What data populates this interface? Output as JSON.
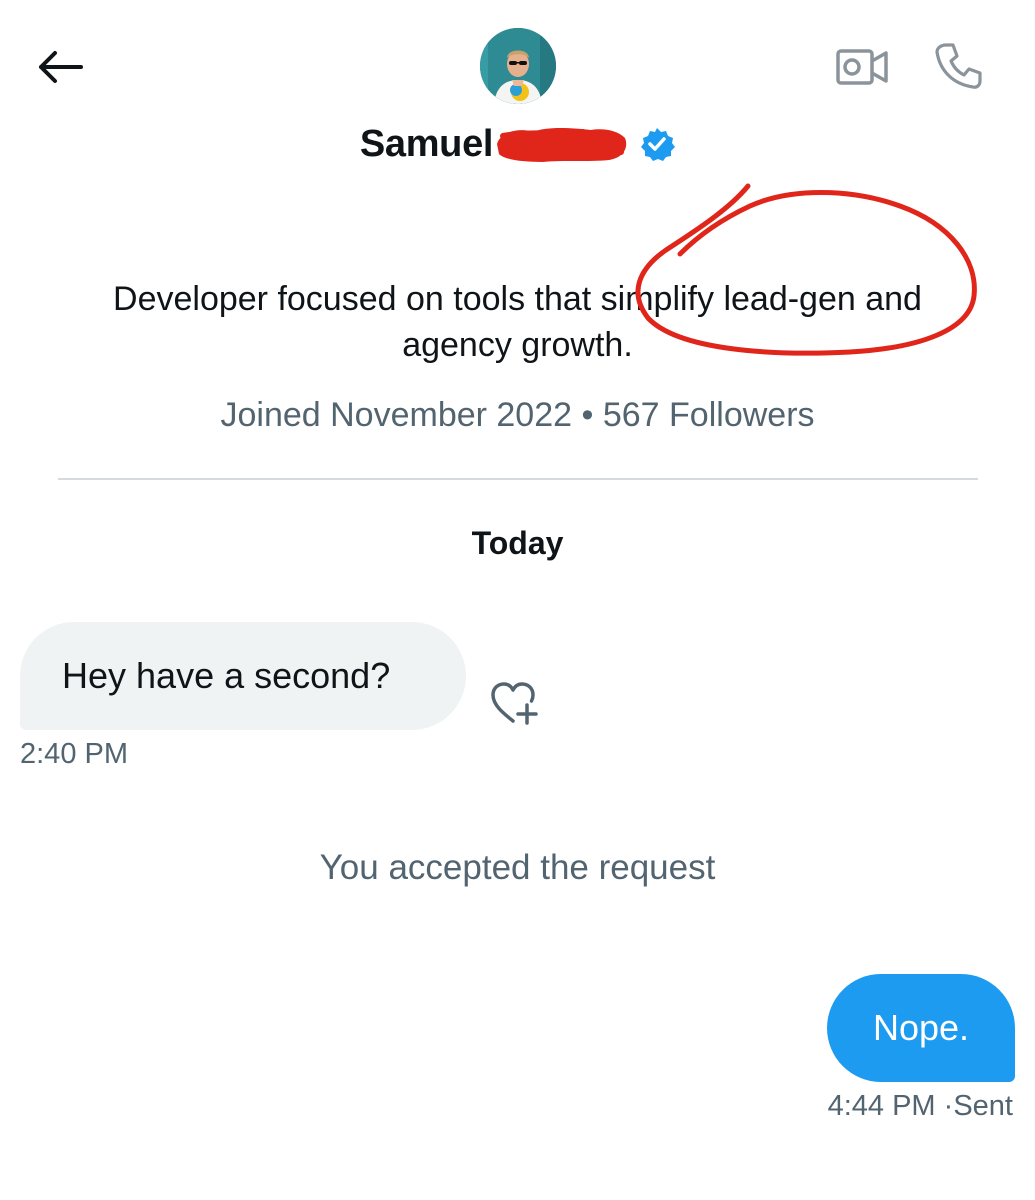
{
  "header": {
    "back_icon": "arrow-left-icon",
    "video_icon": "video-camera-icon",
    "call_icon": "phone-icon"
  },
  "profile": {
    "name": "Samuel",
    "verified_icon": "verified-badge-icon",
    "bio": "Developer focused on tools that simplify lead-gen and agency growth.",
    "joined": "Joined November 2022",
    "separator": "•",
    "followers": "567 Followers"
  },
  "conversation": {
    "day_label": "Today",
    "messages": [
      {
        "direction": "incoming",
        "text": "Hey have a second?",
        "time": "2:40 PM"
      },
      {
        "direction": "outgoing",
        "text": "Nope.",
        "time": "4:44 PM",
        "status": "Sent"
      }
    ],
    "system_message": "You accepted the request",
    "react_icon": "heart-plus-icon"
  },
  "colors": {
    "accent": "#1d9bf0",
    "incoming_bubble": "#eff3f4",
    "secondary_text": "#536471",
    "annotation_red": "#e0261b"
  }
}
